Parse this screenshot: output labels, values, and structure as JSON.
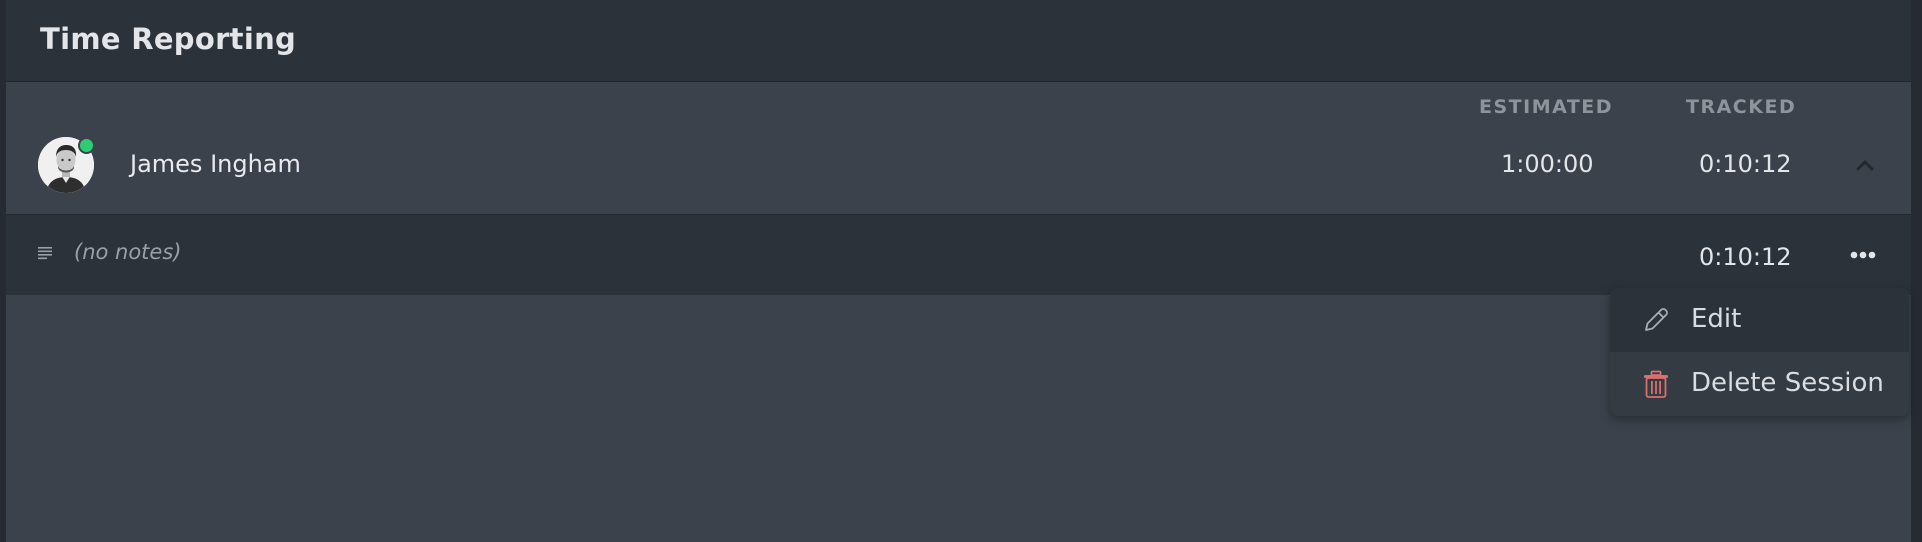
{
  "header": {
    "title": "Time Reporting"
  },
  "columns": {
    "estimated": "ESTIMATED",
    "tracked": "TRACKED"
  },
  "user": {
    "name": "James Ingham",
    "estimated": "1:00:00",
    "tracked": "0:10:12",
    "online": true,
    "status_color": "#2fcd73"
  },
  "session": {
    "notes": "(no notes)",
    "tracked": "0:10:12"
  },
  "menu": {
    "items": [
      {
        "label": "Edit",
        "icon": "pencil-icon"
      },
      {
        "label": "Delete Session",
        "icon": "trash-icon",
        "color": "#d9706e"
      }
    ]
  }
}
